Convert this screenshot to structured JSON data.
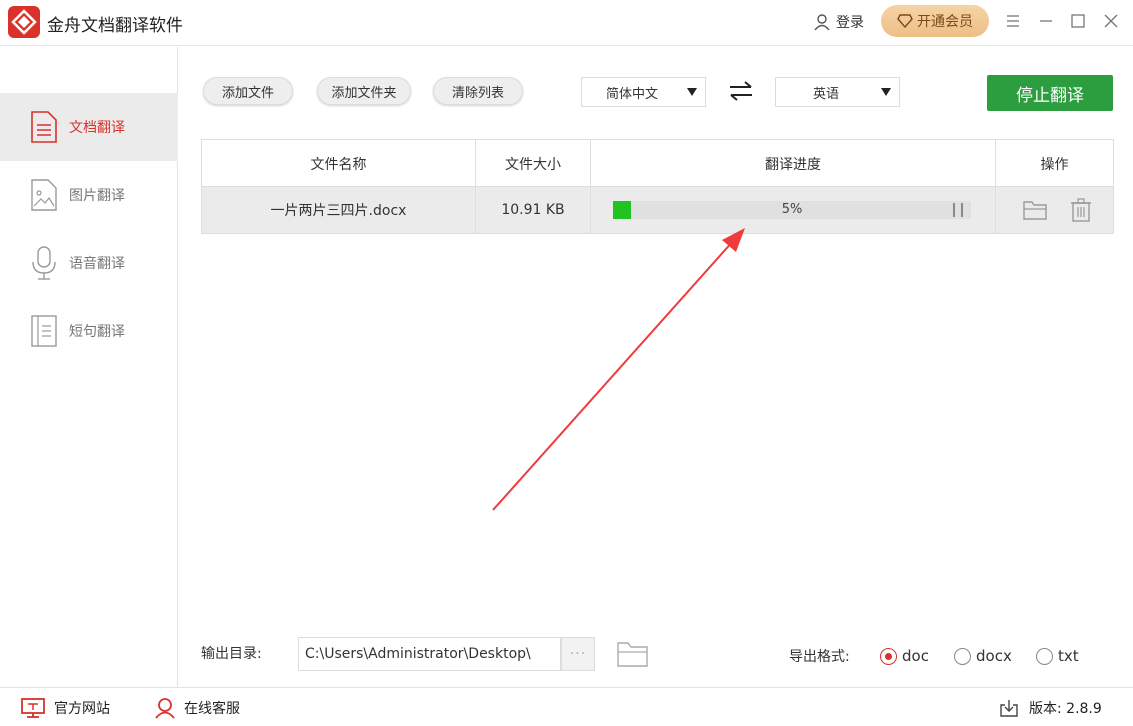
{
  "app": {
    "title": "金舟文档翻译软件",
    "login_label": "登录",
    "vip_label": "开通会员",
    "brand_color": "#d8322a"
  },
  "sidebar": {
    "items": [
      {
        "label": "文档翻译",
        "icon": "document-icon",
        "active": true
      },
      {
        "label": "图片翻译",
        "icon": "image-icon",
        "active": false
      },
      {
        "label": "语音翻译",
        "icon": "microphone-icon",
        "active": false
      },
      {
        "label": "短句翻译",
        "icon": "text-page-icon",
        "active": false
      }
    ]
  },
  "toolbar": {
    "add_file": "添加文件",
    "add_folder": "添加文件夹",
    "clear_list": "清除列表",
    "source_lang": "简体中文",
    "target_lang": "英语",
    "stop_label": "停止翻译",
    "stop_color": "#2c9e3f"
  },
  "table": {
    "headers": [
      "文件名称",
      "文件大小",
      "翻译进度",
      "操作"
    ],
    "rows": [
      {
        "name": "一片两片三四片.docx",
        "size": "10.91 KB",
        "progress_text": "5%",
        "progress": 0.05
      }
    ]
  },
  "output": {
    "label": "输出目录:",
    "path": "C:\\Users\\Administrator\\Desktop\\",
    "more": "···",
    "format_label": "导出格式:",
    "formats": [
      {
        "label": "doc",
        "checked": true
      },
      {
        "label": "docx",
        "checked": false
      },
      {
        "label": "txt",
        "checked": false
      }
    ]
  },
  "status": {
    "website": "官方网站",
    "support": "在线客服",
    "version": "版本: 2.8.9"
  }
}
